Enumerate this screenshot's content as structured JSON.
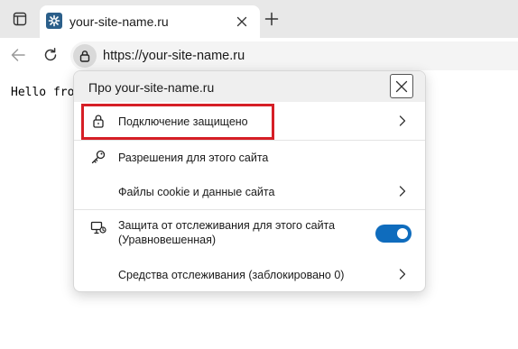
{
  "tab": {
    "title": "your-site-name.ru"
  },
  "toolbar": {
    "url": "https://your-site-name.ru"
  },
  "page": {
    "text": "Hello from"
  },
  "flyout": {
    "title": "Про your-site-name.ru",
    "rows": [
      {
        "label": "Подключение защищено",
        "icon": "lock-icon"
      },
      {
        "label": "Разрешения для этого сайта",
        "icon": "key-icon"
      },
      {
        "label": "Файлы cookie и данные сайта"
      },
      {
        "label": "Защита от отслеживания для этого сайта (Уравновешенная)",
        "icon": "tracking-icon",
        "toggle_on": true
      },
      {
        "label": "Средства отслеживания (заблокировано 0)"
      }
    ]
  },
  "colors": {
    "accent": "#0f6cbd",
    "highlight": "#d61f26"
  }
}
